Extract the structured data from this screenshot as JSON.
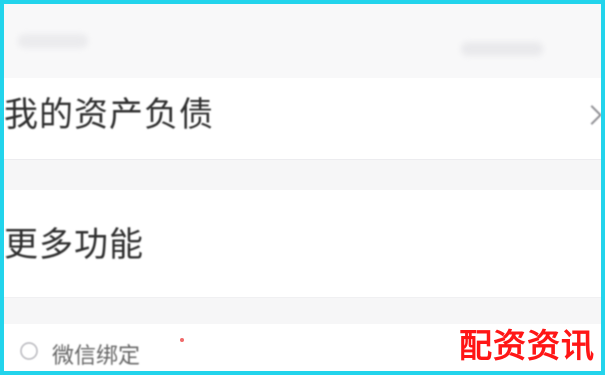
{
  "page": {
    "accent_border_color": "#22d4ec",
    "watermark_color": "#ff1616"
  },
  "menu": {
    "assets_label": "我的资产负债",
    "features_label": "更多功能",
    "wechat_label": "微信绑定"
  },
  "watermark": {
    "text": "配资资讯"
  },
  "icons": {
    "assets_arrow": "chevron-right-icon",
    "wechat_icon": "wechat-icon",
    "notification_dot": "red-dot-icon"
  }
}
